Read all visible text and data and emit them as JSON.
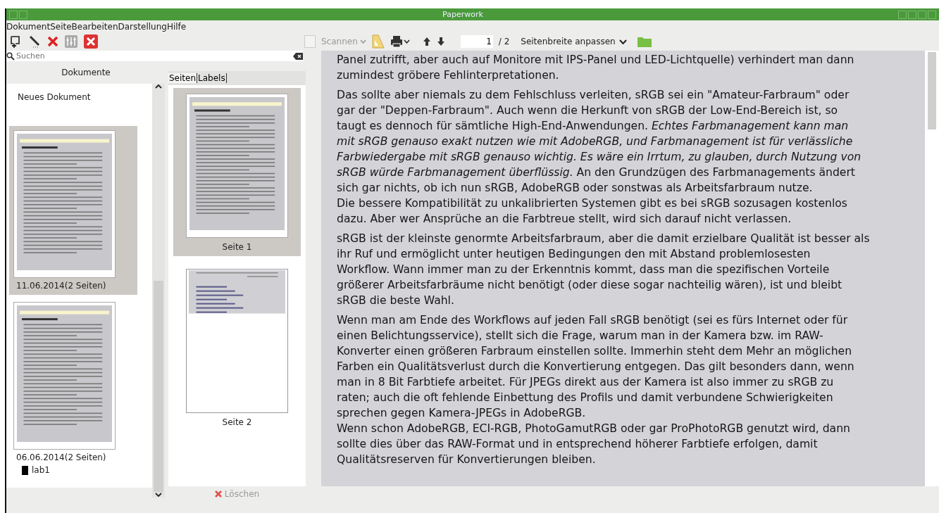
{
  "window": {
    "title": "Paperwork"
  },
  "menu": [
    {
      "label": "Dokument"
    },
    {
      "label": "Seite"
    },
    {
      "label": "Bearbeiten"
    },
    {
      "label": "Darstellung"
    },
    {
      "label": "Hilfe"
    }
  ],
  "search": {
    "placeholder": "Suchen"
  },
  "documents": {
    "header": "Dokumente",
    "items": [
      {
        "kind": "new",
        "label": "Neues Dokument",
        "selected": false
      },
      {
        "kind": "document",
        "label": "11.06.2014(2 Seiten)",
        "selected": true
      },
      {
        "kind": "document",
        "label": "06.06.2014(2 Seiten)",
        "selected": false,
        "labels": [
          {
            "name": "lab1",
            "color": "#000000"
          }
        ]
      }
    ]
  },
  "page_tabs": [
    {
      "label": "Seiten",
      "selected": true
    },
    {
      "label": "Labels",
      "selected": false
    }
  ],
  "pages": [
    {
      "label": "Seite 1",
      "selected": true
    },
    {
      "label": "Seite 2",
      "selected": false
    }
  ],
  "delete_button": {
    "label": "Löschen"
  },
  "viewer_toolbar": {
    "scan": {
      "label": "Scannen",
      "disabled": true
    },
    "page_field": {
      "value": "1",
      "total": "/ 2"
    },
    "zoom": {
      "label": "Seitenbreite anpassen"
    }
  },
  "document": {
    "paragraphs": [
      {
        "lines": [
          {
            "text": "Panel zutrifft, aber auch auf Monitore mit IPS-Panel und LED-Lichtquelle) verhindert man dann",
            "italic": false
          },
          {
            "text": "zumindest gröbere Fehlinterpretationen.",
            "italic": false
          }
        ]
      },
      {
        "lines": [
          {
            "text": "Das sollte aber niemals zu dem Fehlschluss verleiten, sRGB sei ein \"Amateur-Farbraum\" oder",
            "italic": false
          },
          {
            "text": "gar der \"Deppen-Farbraum\". Auch wenn die Herkunft von sRGB der Low-End-Bereich ist, so",
            "italic": false
          },
          {
            "text": "taugt es dennoch für sämtliche High-End-Anwendungen. *Echtes Farbmanagement kann man*",
            "italic": false
          },
          {
            "text": "mit sRGB genauso exakt nutzen wie mit AdobeRGB, und Farbmanagement ist für verlässliche",
            "italic": true
          },
          {
            "text": "Farbwiedergabe mit sRGB genauso wichtig. Es wäre ein Irrtum, zu glauben, durch Nutzung von",
            "italic": true
          },
          {
            "text": "*sRGB würde Farbmanagement überflüssig.* An den Grundzügen des Farbmanagements ändert",
            "italic": false
          },
          {
            "text": "sich gar nichts, ob ich nun sRGB, AdobeRGB oder sonstwas als Arbeitsfarbraum nutze.",
            "italic": false
          },
          {
            "text": "Die bessere Kompatibilität zu unkalibrierten Systemen gibt es bei sRGB sozusagen kostenlos",
            "italic": false
          },
          {
            "text": "dazu. Aber wer Ansprüche an die Farbtreue stellt, wird sich darauf nicht verlassen.",
            "italic": false
          }
        ]
      },
      {
        "lines": [
          {
            "text": "sRGB ist der kleinste genormte Arbeitsfarbraum, aber die damit erzielbare Qualität ist besser als",
            "italic": false
          },
          {
            "text": "ihr Ruf und ermöglicht unter heutigen Bedingungen den mit Abstand problemlosesten",
            "italic": false
          },
          {
            "text": "Workflow. Wann immer man zu der Erkenntnis kommt, dass man die spezifischen Vorteile",
            "italic": false
          },
          {
            "text": "größerer Arbeitsfarbräume nicht benötigt (oder diese sogar nachteilig wären), ist und bleibt",
            "italic": false
          },
          {
            "text": "sRGB die beste Wahl.",
            "italic": false
          }
        ]
      },
      {
        "lines": [
          {
            "text": "Wenn man am Ende des Workflows auf jeden Fall sRGB benötigt (sei es fürs Internet oder für",
            "italic": false
          },
          {
            "text": "einen Belichtungsservice), stellt sich die Frage, warum man in der Kamera bzw. im RAW-",
            "italic": false
          },
          {
            "text": "Konverter einen größeren Farbraum einstellen sollte. Immerhin steht dem Mehr an möglichen",
            "italic": false
          },
          {
            "text": "Farben ein Qualitätsverlust durch die Konvertierung entgegen. Das gilt besonders dann, wenn",
            "italic": false
          },
          {
            "text": "man in 8 Bit Farbtiefe arbeitet. Für JPEGs direkt aus der Kamera ist also immer zu sRGB zu",
            "italic": false
          },
          {
            "text": "raten; auch die oft fehlende Einbettung des Profils und damit verbundene Schwierigkeiten",
            "italic": false
          },
          {
            "text": "sprechen gegen Kamera-JPEGs in AdobeRGB.",
            "italic": false
          },
          {
            "text": "Wenn schon AdobeRGB, ECI-RGB, PhotoGamutRGB oder gar ProPhotoRGB genutzt wird, dann",
            "italic": false
          },
          {
            "text": "sollte dies über das RAW-Format und in entsprechend höherer Farbtiefe erfolgen, damit",
            "italic": false
          },
          {
            "text": "Qualitätsreserven für Konvertierungen bleiben.",
            "italic": false
          }
        ]
      }
    ]
  }
}
